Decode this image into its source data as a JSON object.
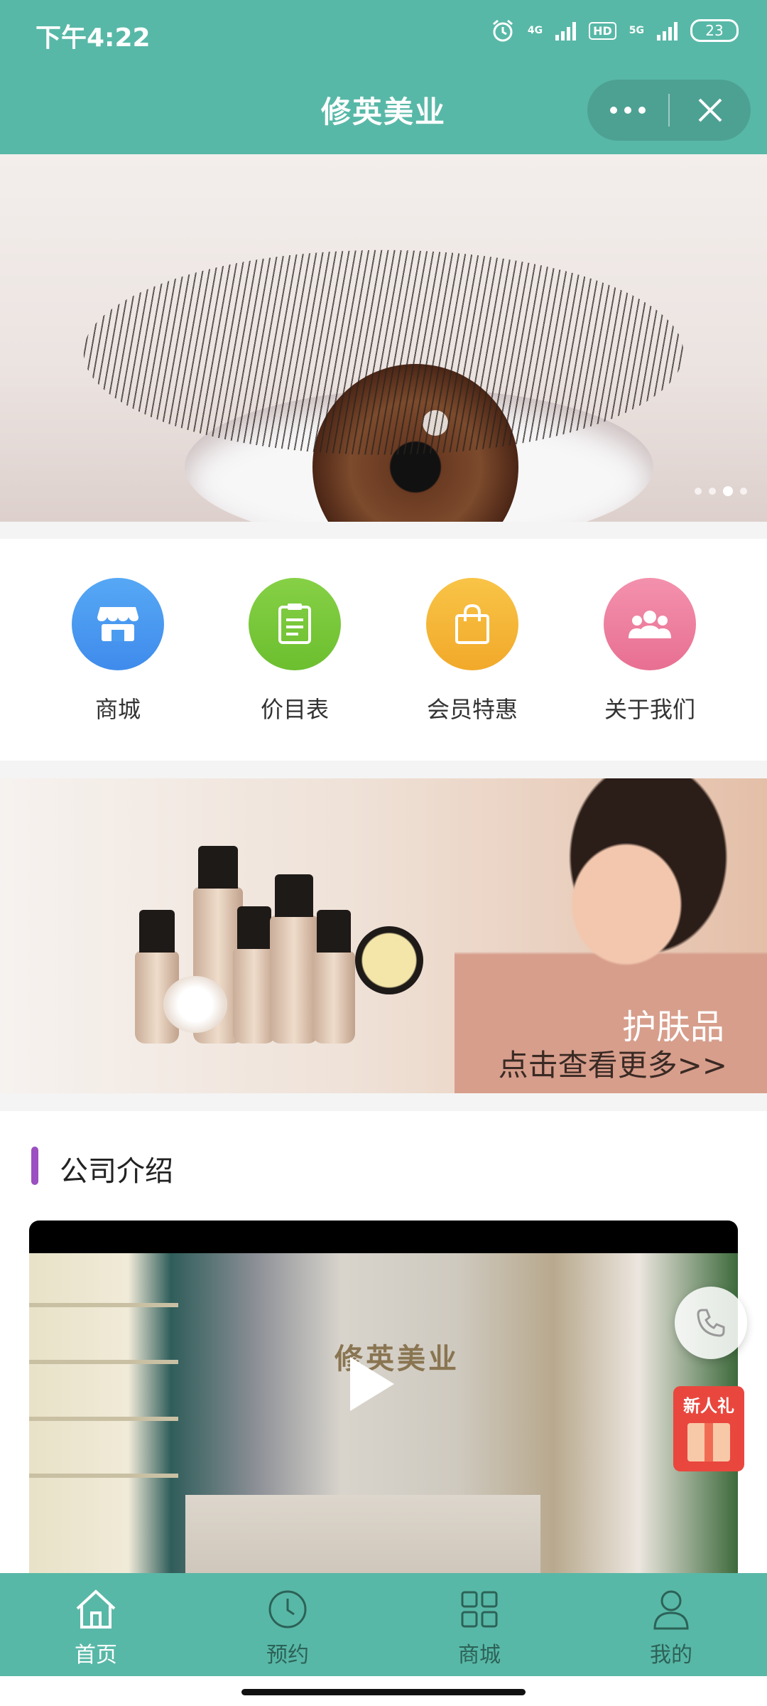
{
  "status_bar": {
    "time": "下午4:22",
    "network_1": "4G",
    "hd": "HD",
    "network_2": "5G",
    "battery": "23"
  },
  "header": {
    "title": "修英美业"
  },
  "hero_banner": {
    "slide_count": 4,
    "active_slide": 3
  },
  "menu": {
    "items": [
      {
        "label": "商城",
        "icon": "store-icon",
        "color": "#4a9cf0"
      },
      {
        "label": "价目表",
        "icon": "price-list-icon",
        "color": "#7cc93a"
      },
      {
        "label": "会员特惠",
        "icon": "shopping-bag-icon",
        "color": "#f5b730"
      },
      {
        "label": "关于我们",
        "icon": "group-icon",
        "color": "#ee7f9e"
      }
    ]
  },
  "promo_banner": {
    "title": "护肤品",
    "subtitle": "点击查看更多>>"
  },
  "company_intro": {
    "title": "公司介绍",
    "video_sign": "修英美业"
  },
  "floating": {
    "gift_label": "新人礼"
  },
  "tabbar": {
    "items": [
      {
        "label": "首页",
        "icon": "home-icon",
        "active": true
      },
      {
        "label": "预约",
        "icon": "clock-icon",
        "active": false
      },
      {
        "label": "商城",
        "icon": "grid-icon",
        "active": false
      },
      {
        "label": "我的",
        "icon": "user-icon",
        "active": false
      }
    ]
  },
  "colors": {
    "brand_teal": "#58b8a7",
    "accent_purple": "#9b4fc0",
    "gift_red": "#e9473e"
  }
}
